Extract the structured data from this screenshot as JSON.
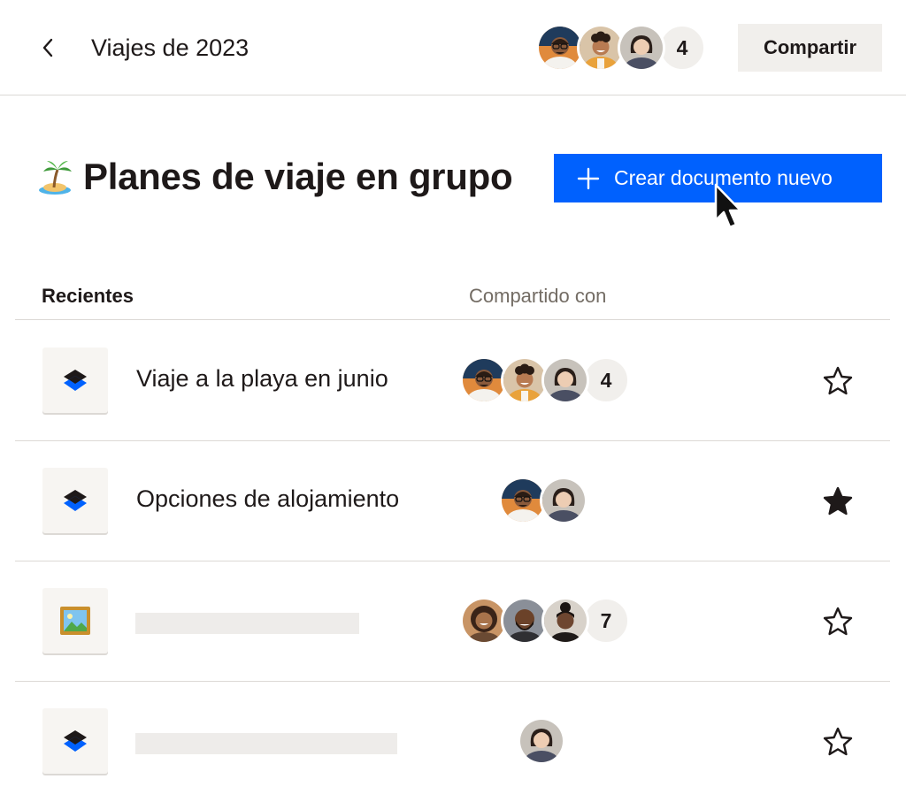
{
  "header": {
    "title": "Viajes de 2023",
    "member_count": "4",
    "share_label": "Compartir"
  },
  "page": {
    "title": "Planes de viaje en grupo",
    "create_button_label": "Crear documento nuevo"
  },
  "list": {
    "col_recent": "Recientes",
    "col_shared": "Compartido con",
    "rows": [
      {
        "name": "Viaje a la playa en junio",
        "file_icon": "dropbox-paper-icon",
        "shared_count": "4",
        "starred": false
      },
      {
        "name": "Opciones de alojamiento",
        "file_icon": "dropbox-paper-icon",
        "shared_count": "",
        "starred": true
      },
      {
        "name": "",
        "file_icon": "image-frame-icon",
        "shared_count": "7",
        "starred": false
      },
      {
        "name": "",
        "file_icon": "dropbox-paper-icon",
        "shared_count": "",
        "starred": false
      }
    ]
  },
  "colors": {
    "primary": "#0061fe",
    "text": "#1e1919",
    "muted": "#736c64",
    "surface": "#f1efec",
    "divider": "#dcd9d5"
  }
}
